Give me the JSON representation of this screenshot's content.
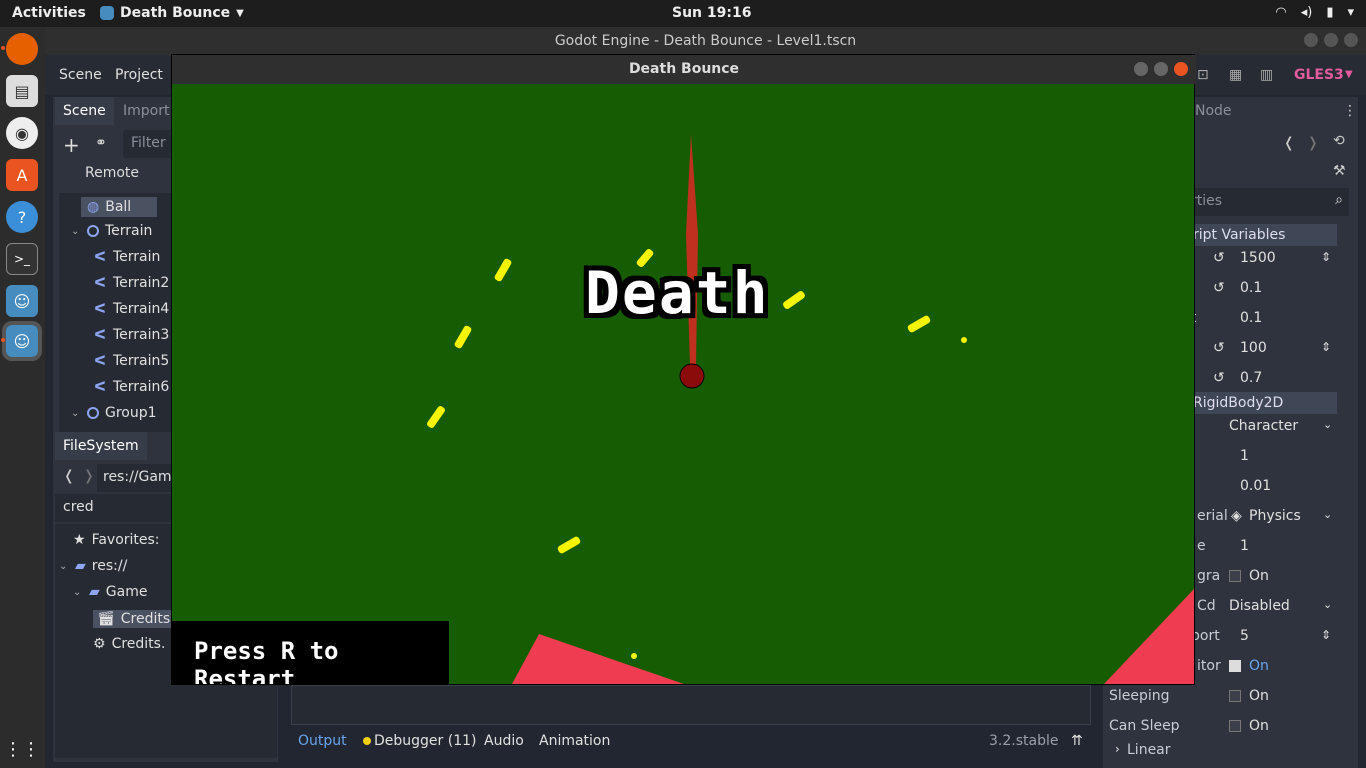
{
  "topbar": {
    "activities": "Activities",
    "app_name": "Death Bounce",
    "clock": "Sun 19:16"
  },
  "editor": {
    "window_title": "Godot Engine - Death Bounce - Level1.tscn",
    "menu": [
      "Scene",
      "Project"
    ],
    "renderer": "GLES3",
    "scene_tabs": [
      "Scene",
      "Import"
    ],
    "filter_placeholder": "Filter r",
    "remote_label": "Remote",
    "tree": [
      {
        "label": "Ball"
      },
      {
        "label": "Terrain"
      },
      {
        "label": "Terrain"
      },
      {
        "label": "Terrain2"
      },
      {
        "label": "Terrain4"
      },
      {
        "label": "Terrain3"
      },
      {
        "label": "Terrain5"
      },
      {
        "label": "Terrain6"
      },
      {
        "label": "Group1"
      }
    ],
    "filesystem": {
      "tab": "FileSystem",
      "path": "res://Gam",
      "search": "cred",
      "items": [
        {
          "label": "Favorites:"
        },
        {
          "label": "res://"
        },
        {
          "label": "Game"
        },
        {
          "label": "Credits."
        },
        {
          "label": "Credits."
        }
      ]
    },
    "inspector": {
      "node_tab": "Node",
      "search_placeholder": "rties",
      "section_script": "ript Variables",
      "section_rigid": "RigidBody2D",
      "rows": [
        {
          "label": "",
          "value": "1500"
        },
        {
          "label": "",
          "value": "0.1"
        },
        {
          "label": "t",
          "value": "0.1"
        },
        {
          "label": "",
          "value": "100"
        },
        {
          "label": "",
          "value": "0.7"
        }
      ],
      "rigid_rows": [
        {
          "label": "",
          "value": "Character"
        },
        {
          "label": "",
          "value": "1"
        },
        {
          "label": "",
          "value": "0.01"
        },
        {
          "label": "erial",
          "value": "Physics"
        },
        {
          "label": "e",
          "value": "1"
        },
        {
          "label": "gra",
          "value": "On"
        },
        {
          "label": "Cd",
          "value": "Disabled"
        },
        {
          "label": "port",
          "value": "5"
        },
        {
          "label": "itor",
          "value": "On"
        },
        {
          "label": "Sleeping",
          "value": "On"
        },
        {
          "label": "Can Sleep",
          "value": "On"
        },
        {
          "label": "Linear",
          "value": ""
        }
      ]
    },
    "bottom_tabs": [
      "Output",
      "Debugger (11)",
      "Audio",
      "Animation"
    ],
    "version": "3.2.stable"
  },
  "game": {
    "window_title": "Death Bounce",
    "death_text": "Death",
    "restart_text": "Press R to Restart",
    "colors": {
      "background": "#155c02",
      "bullet": "#f5f500",
      "spike": "#c0301e",
      "hazard": "#f03c50",
      "ball": "#8b0a0a"
    }
  }
}
